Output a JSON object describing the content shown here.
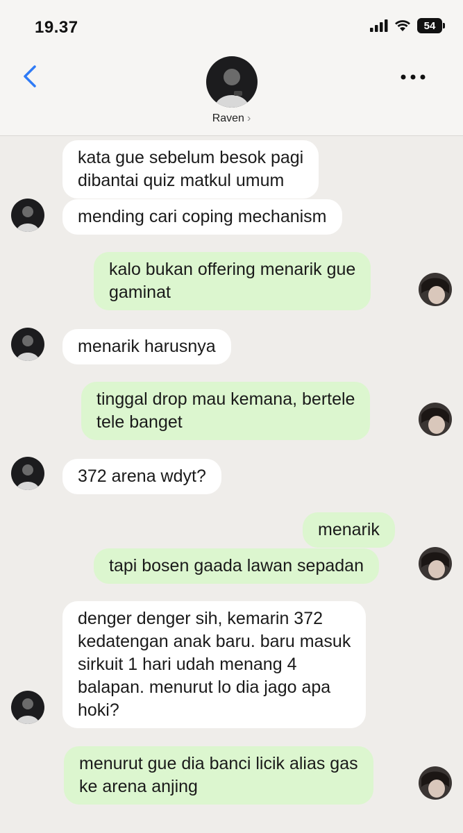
{
  "status_bar": {
    "time": "19.37",
    "battery": "54"
  },
  "header": {
    "contact_name": "Raven",
    "chevron": "›"
  },
  "messages": [
    {
      "side": "in",
      "text_lines": [
        "kata gue sebelum besok pagi",
        "dibantai quiz matkul umum"
      ]
    },
    {
      "side": "in",
      "text_lines": [
        "mending cari coping mechanism"
      ]
    },
    {
      "side": "out",
      "text_lines": [
        "kalo bukan offering menarik gue",
        "gaminat"
      ]
    },
    {
      "side": "in",
      "text_lines": [
        "menarik harusnya"
      ]
    },
    {
      "side": "out",
      "text_lines": [
        "tinggal drop mau kemana, bertele",
        "tele banget"
      ]
    },
    {
      "side": "in",
      "text_lines": [
        "372 arena wdyt?"
      ]
    },
    {
      "side": "out",
      "text_lines": [
        "menarik"
      ]
    },
    {
      "side": "out",
      "text_lines": [
        "tapi bosen gaada lawan sepadan"
      ]
    },
    {
      "side": "in",
      "text_lines": [
        "denger denger sih, kemarin 372",
        "kedatengan anak baru. baru masuk",
        "sirkuit 1 hari udah menang 4",
        "balapan. menurut lo dia jago apa",
        "hoki?"
      ]
    },
    {
      "side": "out",
      "text_lines": [
        "menurut gue dia banci licik alias gas",
        "ke arena anjing"
      ]
    }
  ],
  "colors": {
    "incoming_bubble": "#ffffff",
    "outgoing_bubble": "#dcf6cf",
    "background": "#efedea",
    "accent": "#2f7bf6"
  },
  "icons": [
    "back-chevron-icon",
    "more-dots-icon",
    "signal-icon",
    "wifi-icon",
    "battery-icon"
  ]
}
